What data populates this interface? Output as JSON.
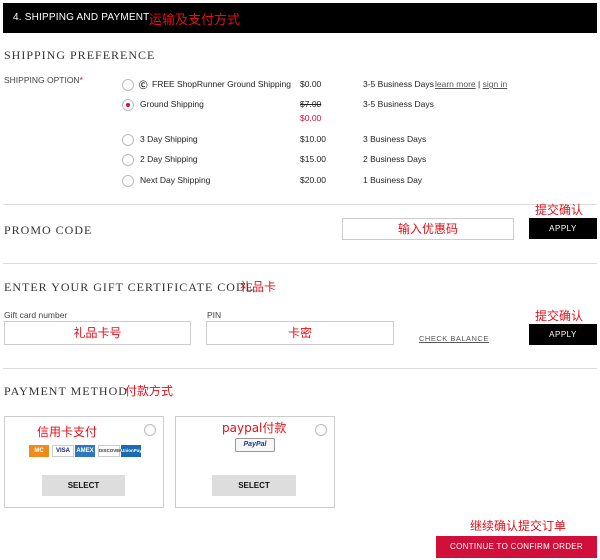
{
  "header": {
    "title": "4. SHIPPING AND PAYMENT",
    "note": "运输及支付方式"
  },
  "shipping": {
    "section_title": "SHIPPING PREFERENCE",
    "option_label": "SHIPPING OPTION",
    "required_mark": "*",
    "options": [
      {
        "name": "FREE ShopRunner Ground Shipping",
        "price": "$0.00",
        "time": "3-5 Business Days",
        "learn_more": "learn more",
        "separator": "|",
        "sign_in": "sign in"
      },
      {
        "name": "Ground Shipping",
        "price_original": "$7.00",
        "price": "$0.00",
        "time": "3-5 Business Days",
        "selected": true
      },
      {
        "name": "3 Day Shipping",
        "price": "$10.00",
        "time": "3 Business Days"
      },
      {
        "name": "2 Day Shipping",
        "price": "$15.00",
        "time": "2 Business Days"
      },
      {
        "name": "Next Day Shipping",
        "price": "$20.00",
        "time": "1 Business Day"
      }
    ]
  },
  "promo": {
    "section_title": "PROMO CODE",
    "placeholder": "输入优惠码",
    "note": "提交确认",
    "apply": "APPLY"
  },
  "gift": {
    "section_title": "ENTER YOUR GIFT CERTIFICATE CODE",
    "title_note": "礼品卡",
    "card_label": "Gift card number",
    "card_placeholder": "礼品卡号",
    "pin_label": "PIN",
    "pin_placeholder": "卡密",
    "check_balance": "CHECK BALANCE",
    "note": "提交确认",
    "apply": "APPLY"
  },
  "payment": {
    "section_title": "PAYMENT METHOD",
    "title_note": "付款方式",
    "methods": [
      {
        "note": "信用卡支付",
        "select": "SELECT",
        "cards": [
          "MC",
          "VISA",
          "AMEX",
          "DISCOVER",
          "UnionPay"
        ]
      },
      {
        "note": "paypal付款",
        "select": "SELECT",
        "badge": "PayPal"
      }
    ]
  },
  "footer": {
    "note": "继续确认提交订单",
    "continue": "CONTINUE TO CONFIRM ORDER"
  },
  "colors": {
    "accent": "#d0103a",
    "annotation": "#e0101a",
    "header_bg": "#000000"
  }
}
